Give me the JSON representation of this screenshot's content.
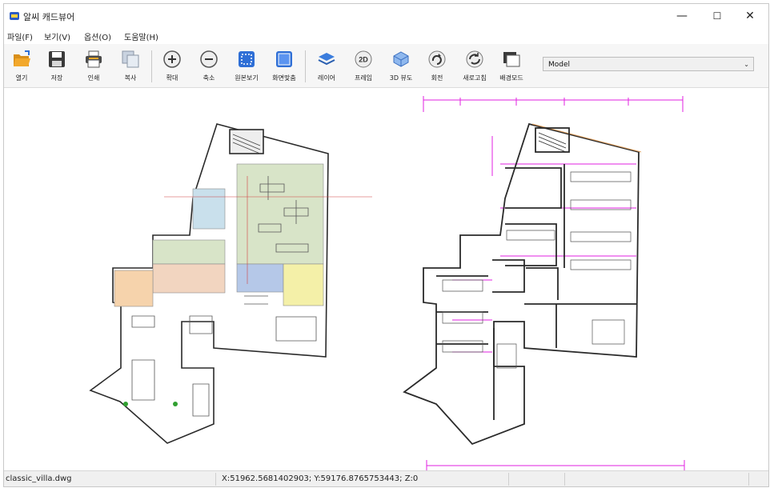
{
  "window": {
    "title": "알씨 캐드뷰어"
  },
  "window_controls": {
    "minimize": "—",
    "maximize": "☐",
    "close": "✕"
  },
  "menu": [
    "파일(F)",
    "보기(V)",
    "옵션(O)",
    "도움말(H)"
  ],
  "toolbar": {
    "buttons": [
      "열기",
      "저장",
      "인쇄",
      "복사",
      "확대",
      "축소",
      "원본보기",
      "화면맞춤",
      "레이어",
      "프레임",
      "3D 뷰도",
      "회전",
      "새로고침",
      "배경모드"
    ],
    "frame_icon_text": "2D",
    "colors": {
      "open": "#f2a82b",
      "save": "#3a3a3a",
      "zoom": "#5a5a5a",
      "fit": "#2f6fd6",
      "layer": "#3b7ddd"
    }
  },
  "model_select": {
    "value": "Model"
  },
  "drawing_colors": {
    "wall": "#2a2a2a",
    "dimension": "#e020e0",
    "accent": "#e0a060"
  },
  "status": {
    "file": "classic_villa.dwg",
    "coords": "X:51962.5681402903; Y:59176.8765753443; Z:0"
  }
}
